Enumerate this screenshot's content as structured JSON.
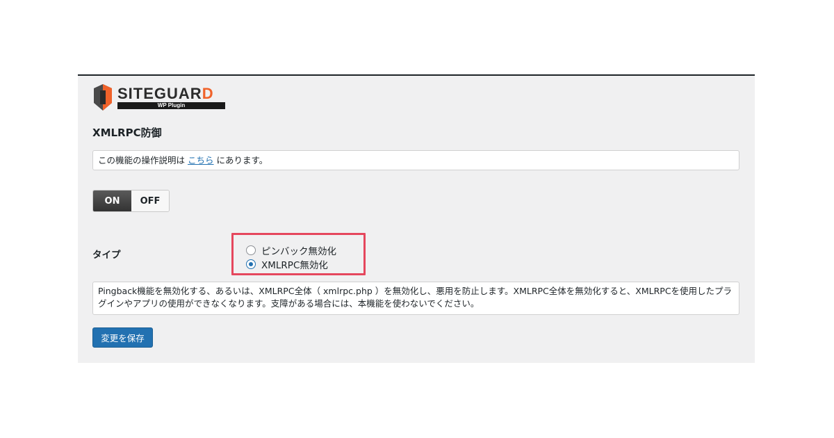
{
  "logo": {
    "brand_main": "SITEGUAR",
    "brand_last": "D",
    "subtitle": "WP Plugin"
  },
  "page": {
    "title": "XMLRPC防御"
  },
  "notice": {
    "prefix": "この機能の操作説明は",
    "link": "こちら",
    "suffix": "にあります。"
  },
  "toggle": {
    "on_label": "ON",
    "off_label": "OFF",
    "selected": "ON"
  },
  "type_field": {
    "label": "タイプ",
    "options": [
      {
        "label": "ピンバック無効化",
        "checked": false
      },
      {
        "label": "XMLRPC無効化",
        "checked": true
      }
    ]
  },
  "description": "Pingback機能を無効化する、あるいは、XMLRPC全体（ xmlrpc.php ）を無効化し、悪用を防止します。XMLRPC全体を無効化すると、XMLRPCを使用したプラグインやアプリの使用ができなくなります。支障がある場合には、本機能を使わないでください。",
  "actions": {
    "save_label": "変更を保存"
  },
  "colors": {
    "accent": "#2271b1",
    "highlight": "#e5475d",
    "logo_orange": "#f0622a"
  }
}
